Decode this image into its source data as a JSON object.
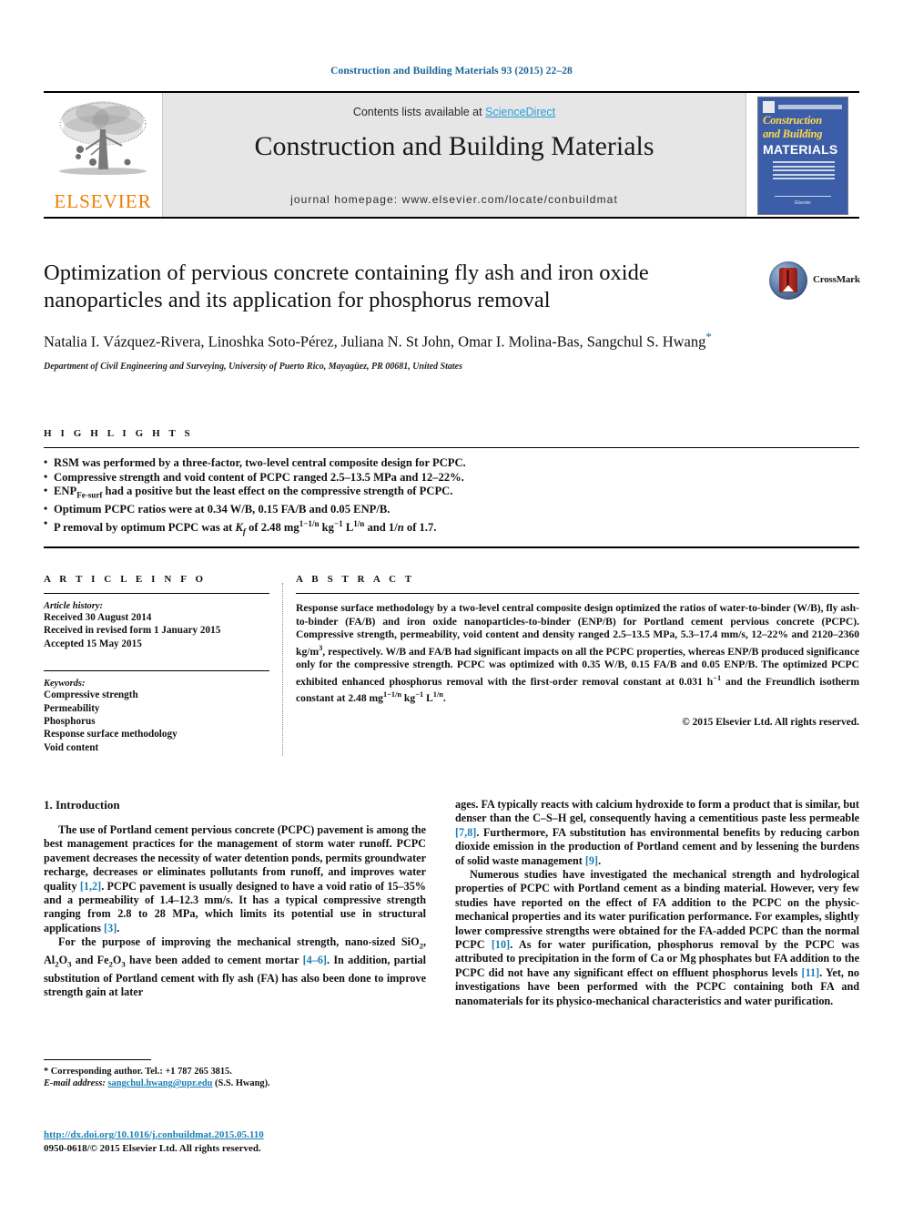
{
  "running_head": "Construction and Building Materials 93 (2015) 22–28",
  "masthead": {
    "publisher": "ELSEVIER",
    "contents_prefix": "Contents lists available at ",
    "contents_link": "ScienceDirect",
    "journal_title": "Construction and Building Materials",
    "homepage": "journal homepage: www.elsevier.com/locate/conbuildmat",
    "cover": {
      "line1": "Construction",
      "line2": "and Building",
      "line3": "MATERIALS",
      "footer": "Elsevier"
    }
  },
  "article": {
    "title": "Optimization of pervious concrete containing fly ash and iron oxide nanoparticles and its application for phosphorus removal",
    "authors": "Natalia I. Vázquez-Rivera, Linoshka Soto-Pérez, Juliana N. St John, Omar I. Molina-Bas, Sangchul S. Hwang",
    "corresponding_marker": "*",
    "affiliation": "Department of Civil Engineering and Surveying, University of Puerto Rico, Mayagüez, PR 00681, United States",
    "crossmark_label": "CrossMark"
  },
  "highlights": {
    "heading": "H I G H L I G H T S",
    "items": [
      "RSM was performed by a three-factor, two-level central composite design for PCPC.",
      "Compressive strength and void content of PCPC ranged 2.5–13.5 MPa and 12–22%.",
      "ENP<sub>Fe-surf</sub> had a positive but the least effect on the compressive strength of PCPC.",
      "Optimum PCPC ratios were at 0.34 W/B, 0.15 FA/B and 0.05 ENP/B.",
      "P removal by optimum PCPC was at <span class=\"ital\">K<sub>f</sub></span> of 2.48 mg<sup>1−1/n</sup> kg<sup>−1</sup> L<sup>1/n</sup> and 1/<span class=\"ital\">n</span> of 1.7."
    ]
  },
  "article_info": {
    "heading": "A R T I C L E  I N F O",
    "history_label": "Article history:",
    "history": [
      "Received 30 August 2014",
      "Received in revised form 1 January 2015",
      "Accepted 15 May 2015"
    ],
    "keywords_label": "Keywords:",
    "keywords": [
      "Compressive strength",
      "Permeability",
      "Phosphorus",
      "Response surface methodology",
      "Void content"
    ]
  },
  "abstract": {
    "heading": "A B S T R A C T",
    "body": "Response surface methodology by a two-level central composite design optimized the ratios of water-to-binder (W/B), fly ash-to-binder (FA/B) and iron oxide nanoparticles-to-binder (ENP/B) for Portland cement pervious concrete (PCPC). Compressive strength, permeability, void content and density ranged 2.5–13.5 MPa, 5.3–17.4 mm/s, 12–22% and 2120–2360 kg/m<sup>3</sup>, respectively. W/B and FA/B had significant impacts on all the PCPC properties, whereas ENP/B produced significance only for the compressive strength. PCPC was optimized with 0.35 W/B, 0.15 FA/B and 0.05 ENP/B. The optimized PCPC exhibited enhanced phosphorus removal with the first-order removal constant at 0.031 h<sup>−1</sup> and the Freundlich isotherm constant at 2.48 mg<sup>1−1/n</sup> kg<sup>−1</sup> L<sup>1/n</sup>.",
    "copyright": "© 2015 Elsevier Ltd. All rights reserved."
  },
  "introduction": {
    "heading": "1. Introduction",
    "left_paragraphs": [
      "The use of Portland cement pervious concrete (PCPC) pavement is among the best management practices for the management of storm water runoff. PCPC pavement decreases the necessity of water detention ponds, permits groundwater recharge, decreases or eliminates pollutants from runoff, and improves water quality <span class=\"ref\">[1,2]</span>. PCPC pavement is usually designed to have a void ratio of 15–35% and a permeability of 1.4–12.3 mm/s. It has a typical compressive strength ranging from 2.8 to 28 MPa, which limits its potential use in structural applications <span class=\"ref\">[3]</span>.",
      "For the purpose of improving the mechanical strength, nano-sized SiO<sub>2</sub>, Al<sub>2</sub>O<sub>3</sub> and Fe<sub>2</sub>O<sub>3</sub> have been added to cement mortar <span class=\"ref\">[4–6]</span>. In addition, partial substitution of Portland cement with fly ash (FA) has also been done to improve strength gain at later"
    ],
    "right_paragraphs": [
      "ages. FA typically reacts with calcium hydroxide to form a product that is similar, but denser than the C–S–H gel, consequently having a cementitious paste less permeable <span class=\"ref\">[7,8]</span>. Furthermore, FA substitution has environmental benefits by reducing carbon dioxide emission in the production of Portland cement and by lessening the burdens of solid waste management <span class=\"ref\">[9]</span>.",
      "Numerous studies have investigated the mechanical strength and hydrological properties of PCPC with Portland cement as a binding material. However, very few studies have reported on the effect of FA addition to the PCPC on the physic-mechanical properties and its water purification performance. For examples, slightly lower compressive strengths were obtained for the FA-added PCPC than the normal PCPC <span class=\"ref\">[10]</span>. As for water purification, phosphorus removal by the PCPC was attributed to precipitation in the form of Ca or Mg phosphates but FA addition to the PCPC did not have any significant effect on effluent phosphorus levels <span class=\"ref\">[11]</span>. Yet, no investigations have been performed with the PCPC containing both FA and nanomaterials for its physico-mechanical characteristics and water purification."
    ]
  },
  "footnote": {
    "corresponding": "<b>*</b> Corresponding author. Tel.: +1 787 265 3815.",
    "email_label": "E-mail address:",
    "email": "sangchul.hwang@upr.edu",
    "email_suffix": "(S.S. Hwang).",
    "doi": "http://dx.doi.org/10.1016/j.conbuildmat.2015.05.110",
    "issn": "0950-0618/© 2015 Elsevier Ltd. All rights reserved."
  },
  "colors": {
    "link": "#1a7fb5",
    "running_head": "#1a6496",
    "elsevier_orange": "#F07D00",
    "sciencedirect": "#2b9fd6",
    "cover_blue": "#3c5ea8"
  }
}
